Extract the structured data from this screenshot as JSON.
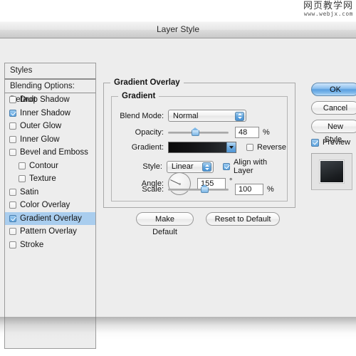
{
  "watermark": {
    "cn": "网页教学网",
    "url": "www.webjx.com"
  },
  "window": {
    "title": "Layer Style"
  },
  "sidebar": {
    "header": "Styles",
    "blending_options": "Blending Options: Default",
    "items": [
      {
        "label": "Drop Shadow",
        "checked": false,
        "sub": false,
        "selected": false
      },
      {
        "label": "Inner Shadow",
        "checked": true,
        "sub": false,
        "selected": false
      },
      {
        "label": "Outer Glow",
        "checked": false,
        "sub": false,
        "selected": false
      },
      {
        "label": "Inner Glow",
        "checked": false,
        "sub": false,
        "selected": false
      },
      {
        "label": "Bevel and Emboss",
        "checked": false,
        "sub": false,
        "selected": false
      },
      {
        "label": "Contour",
        "checked": false,
        "sub": true,
        "selected": false
      },
      {
        "label": "Texture",
        "checked": false,
        "sub": true,
        "selected": false
      },
      {
        "label": "Satin",
        "checked": false,
        "sub": false,
        "selected": false
      },
      {
        "label": "Color Overlay",
        "checked": false,
        "sub": false,
        "selected": false
      },
      {
        "label": "Gradient Overlay",
        "checked": true,
        "sub": false,
        "selected": true
      },
      {
        "label": "Pattern Overlay",
        "checked": false,
        "sub": false,
        "selected": false
      },
      {
        "label": "Stroke",
        "checked": false,
        "sub": false,
        "selected": false
      }
    ]
  },
  "main": {
    "group_title": "Gradient Overlay",
    "subgroup_title": "Gradient",
    "blend_mode": {
      "label": "Blend Mode:",
      "value": "Normal"
    },
    "opacity": {
      "label": "Opacity:",
      "value": "48",
      "unit": "%",
      "percent": 45
    },
    "gradient": {
      "label": "Gradient:",
      "reverse_label": "Reverse",
      "reverse_checked": false
    },
    "style": {
      "label": "Style:",
      "value": "Linear",
      "align_label": "Align with Layer",
      "align_checked": true
    },
    "angle": {
      "label": "Angle:",
      "value": "155",
      "unit": "°",
      "degrees": 155
    },
    "scale": {
      "label": "Scale:",
      "value": "100",
      "unit": "%",
      "percent": 60
    },
    "make_default": "Make Default",
    "reset_default": "Reset to Default"
  },
  "right": {
    "ok": "OK",
    "cancel": "Cancel",
    "new_style": "New Style..",
    "preview_label": "Preview",
    "preview_checked": true
  }
}
